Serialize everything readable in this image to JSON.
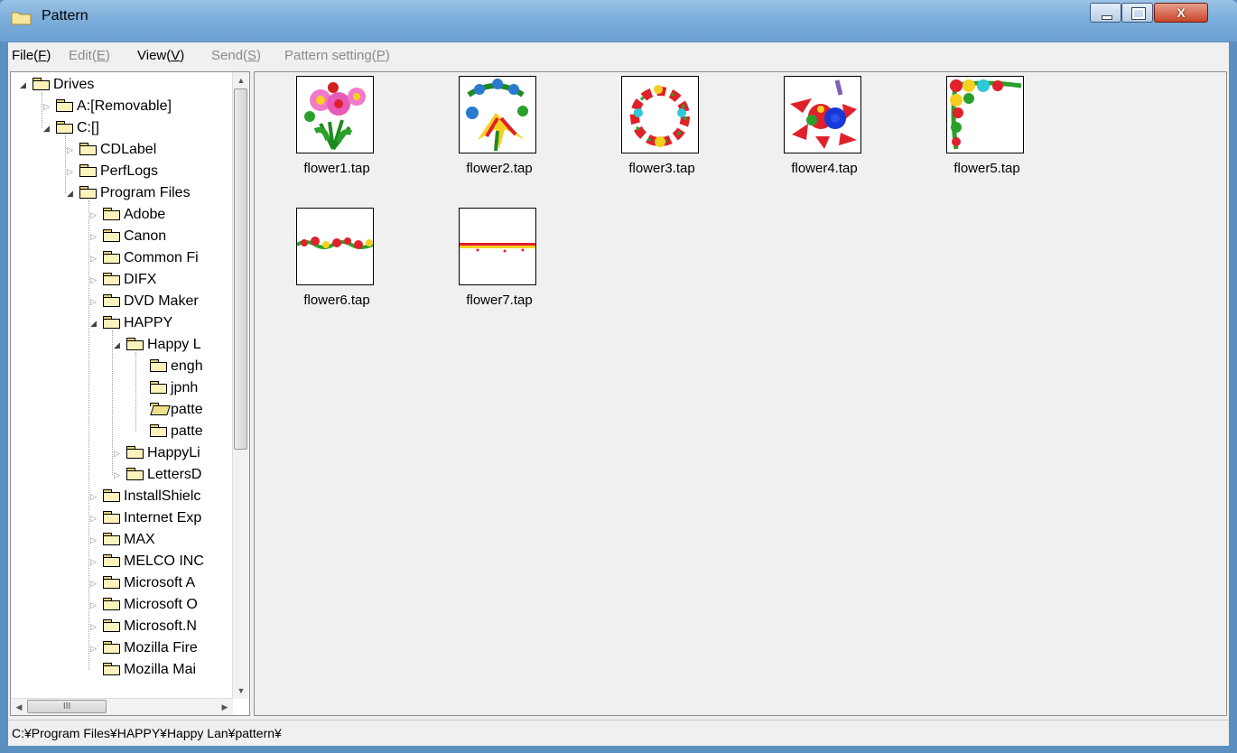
{
  "window": {
    "title": "Pattern",
    "close_glyph": "X"
  },
  "menu": [
    {
      "label": "File(",
      "key": "F",
      "tail": ")",
      "enabled": true
    },
    {
      "label": "Edit(",
      "key": "E",
      "tail": ")",
      "enabled": false
    },
    {
      "label": "View(",
      "key": "V",
      "tail": ")",
      "enabled": true
    },
    {
      "label": "Send(",
      "key": "S",
      "tail": ")",
      "enabled": false
    },
    {
      "label": "Pattern setting(",
      "key": "P",
      "tail": ")",
      "enabled": false
    }
  ],
  "tree": {
    "nodes": [
      {
        "label": "Drives",
        "depth": 0,
        "toggle": "open"
      },
      {
        "label": "A:[Removable]",
        "depth": 1,
        "toggle": "closed"
      },
      {
        "label": "C:[]",
        "depth": 1,
        "toggle": "open"
      },
      {
        "label": "CDLabel",
        "depth": 2,
        "toggle": "closed"
      },
      {
        "label": "PerfLogs",
        "depth": 2,
        "toggle": "closed"
      },
      {
        "label": "Program Files",
        "depth": 2,
        "toggle": "open"
      },
      {
        "label": "Adobe",
        "depth": 3,
        "toggle": "closed"
      },
      {
        "label": "Canon",
        "depth": 3,
        "toggle": "closed"
      },
      {
        "label": "Common Fi",
        "depth": 3,
        "toggle": "closed"
      },
      {
        "label": "DIFX",
        "depth": 3,
        "toggle": "closed"
      },
      {
        "label": "DVD Maker",
        "depth": 3,
        "toggle": "closed"
      },
      {
        "label": "HAPPY",
        "depth": 3,
        "toggle": "open"
      },
      {
        "label": "Happy L",
        "depth": 4,
        "toggle": "open"
      },
      {
        "label": "engh",
        "depth": 5,
        "toggle": "none"
      },
      {
        "label": "jpnh",
        "depth": 5,
        "toggle": "none"
      },
      {
        "label": "patte",
        "depth": 5,
        "toggle": "none",
        "selected": true
      },
      {
        "label": "patte",
        "depth": 5,
        "toggle": "none"
      },
      {
        "label": "HappyLi",
        "depth": 4,
        "toggle": "closed"
      },
      {
        "label": "LettersD",
        "depth": 4,
        "toggle": "closed"
      },
      {
        "label": "InstallShielc",
        "depth": 3,
        "toggle": "closed"
      },
      {
        "label": "Internet Exp",
        "depth": 3,
        "toggle": "closed"
      },
      {
        "label": "MAX",
        "depth": 3,
        "toggle": "closed"
      },
      {
        "label": "MELCO INC",
        "depth": 3,
        "toggle": "closed"
      },
      {
        "label": "Microsoft A",
        "depth": 3,
        "toggle": "closed"
      },
      {
        "label": "Microsoft O",
        "depth": 3,
        "toggle": "closed"
      },
      {
        "label": "Microsoft.N",
        "depth": 3,
        "toggle": "closed"
      },
      {
        "label": "Mozilla Fire",
        "depth": 3,
        "toggle": "closed"
      },
      {
        "label": "Mozilla Mai",
        "depth": 3,
        "toggle": "none"
      }
    ],
    "hscroll_glyph": "III"
  },
  "patterns": [
    {
      "name": "flower1.tap",
      "icon": "bouquet-pattern"
    },
    {
      "name": "flower2.tap",
      "icon": "lily-bouquet-pattern"
    },
    {
      "name": "flower3.tap",
      "icon": "wreath-pattern"
    },
    {
      "name": "flower4.tap",
      "icon": "rose-cluster-pattern"
    },
    {
      "name": "flower5.tap",
      "icon": "corner-garland-pattern"
    },
    {
      "name": "flower6.tap",
      "icon": "border-strip-pattern"
    },
    {
      "name": "flower7.tap",
      "icon": "thin-border-pattern"
    }
  ],
  "status": {
    "path": "C:¥Program Files¥HAPPY¥Happy Lan¥pattern¥"
  },
  "colors": {
    "title_bar": "#7fb0dc",
    "close_button": "#c8442b",
    "folder": "#fbf3bb"
  }
}
